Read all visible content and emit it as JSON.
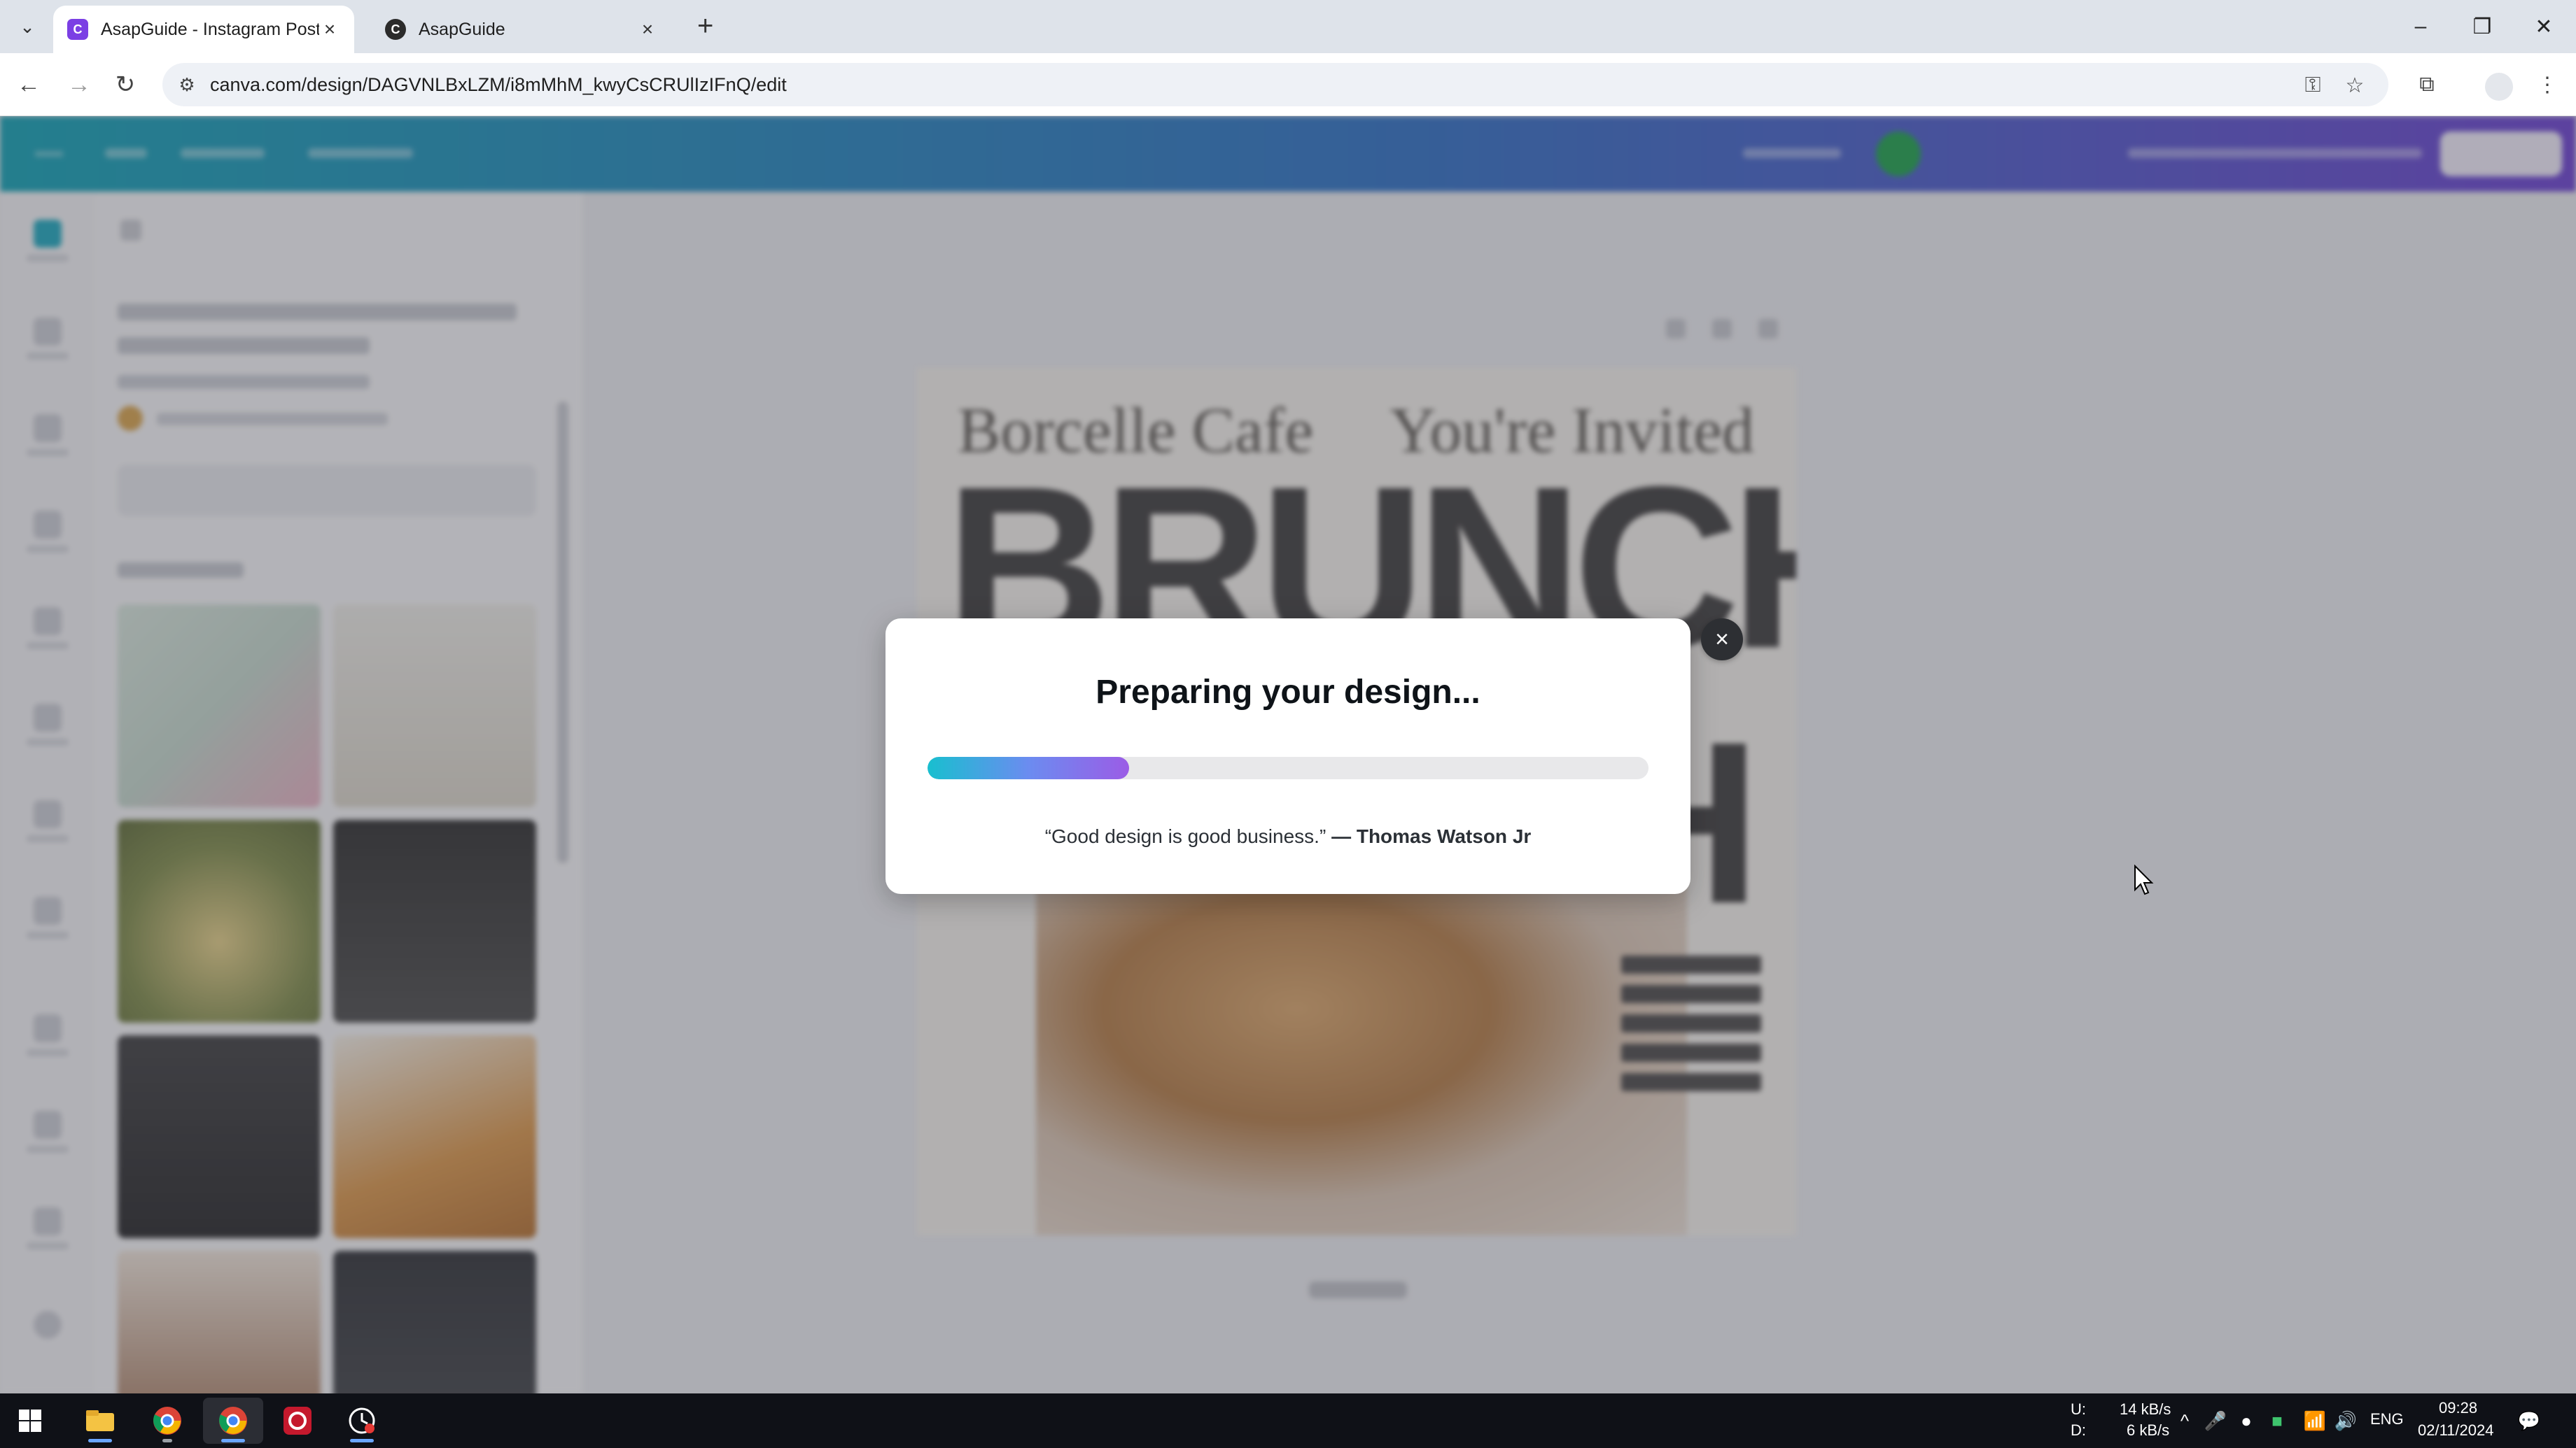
{
  "browser": {
    "tabs": [
      {
        "label": "AsapGuide - Instagram Post",
        "active": true
      },
      {
        "label": "AsapGuide",
        "active": false
      }
    ],
    "url": "canva.com/design/DAGVNLBxLZM/i8mMhM_kwyCsCRUlIzIFnQ/edit"
  },
  "canvas_art": {
    "cafe": "Borcelle Cafe",
    "invited": "You're Invited",
    "headline": "BRUNCH",
    "headline_tail": "H"
  },
  "modal": {
    "title": "Preparing your design...",
    "progress": 0.28,
    "quote_text": "“Good design is good business.”",
    "quote_author": "— Thomas Watson Jr",
    "close_label": "×"
  },
  "taskbar": {
    "net_upload_label": "U:",
    "net_download_label": "D:",
    "net_upload": "14 kB/s",
    "net_download": "6 kB/s",
    "language": "ENG",
    "time": "09:28",
    "date": "02/11/2024"
  },
  "colors": {
    "header_gradient_start": "#0fa1b4",
    "header_gradient_end": "#6a3fd0",
    "progress_start": "#18bfcf",
    "progress_end": "#9b5ce6",
    "taskbar": "#0f1117"
  }
}
